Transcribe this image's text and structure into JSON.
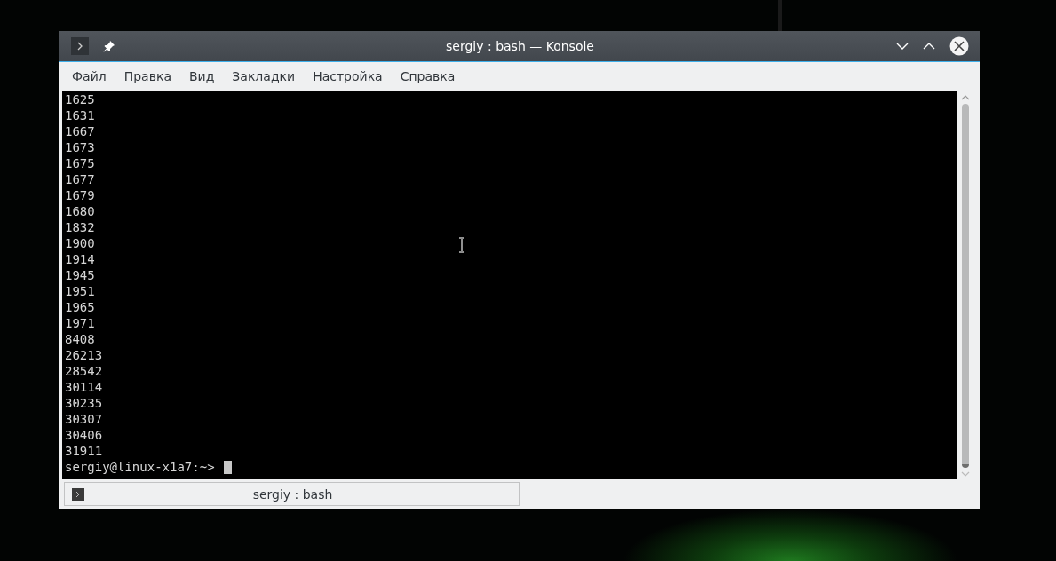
{
  "window": {
    "title": "sergiy : bash — Konsole"
  },
  "menu": [
    "Файл",
    "Правка",
    "Вид",
    "Закладки",
    "Настройка",
    "Справка"
  ],
  "terminal": {
    "lines": [
      "1625",
      "1631",
      "1667",
      "1673",
      "1675",
      "1677",
      "1679",
      "1680",
      "1832",
      "1900",
      "1914",
      "1945",
      "1951",
      "1965",
      "1971",
      "8408",
      "26213",
      "28542",
      "30114",
      "30235",
      "30307",
      "30406",
      "31911"
    ],
    "prompt": "sergiy@linux-x1a7:~>"
  },
  "tabs": [
    {
      "label": "sergiy : bash"
    }
  ]
}
